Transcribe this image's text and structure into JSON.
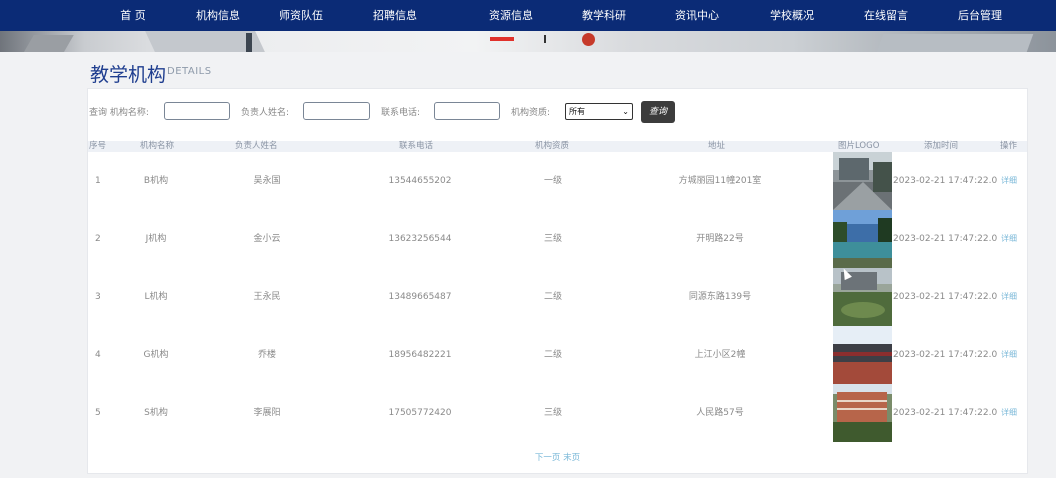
{
  "nav": {
    "items": [
      {
        "key": "home",
        "label": "首 页"
      },
      {
        "key": "org",
        "label": "机构信息"
      },
      {
        "key": "teachers",
        "label": "师资队伍"
      },
      {
        "key": "recruit",
        "label": "招聘信息"
      },
      {
        "key": "resources",
        "label": "资源信息"
      },
      {
        "key": "research",
        "label": "教学科研"
      },
      {
        "key": "news",
        "label": "资讯中心"
      },
      {
        "key": "overview",
        "label": "学校概况"
      },
      {
        "key": "message",
        "label": "在线留言"
      },
      {
        "key": "admin",
        "label": "后台管理"
      }
    ]
  },
  "page": {
    "title": "教学机构",
    "subtitle": "DETAILS"
  },
  "search": {
    "name_label": "查询 机构名称:",
    "name_value": "",
    "leader_label": "负责人姓名:",
    "leader_value": "",
    "phone_label": "联系电话:",
    "phone_value": "",
    "level_label": "机构资质:",
    "level_selected": "所有",
    "button_label": "查询"
  },
  "table": {
    "headers": [
      "序号",
      "机构名称",
      "负责人姓名",
      "联系电话",
      "机构资质",
      "地址",
      "图片LOGO",
      "添加时间",
      "操作"
    ],
    "rows": [
      {
        "no": "1",
        "name": "B机构",
        "leader": "吴永国",
        "phone": "13544655202",
        "level": "一级",
        "address": "方城丽园11幢201室",
        "time": "2023-02-21 17:47:22.0",
        "action": "详细"
      },
      {
        "no": "2",
        "name": "J机构",
        "leader": "金小云",
        "phone": "13623256544",
        "level": "三级",
        "address": "开明路22号",
        "time": "2023-02-21 17:47:22.0",
        "action": "详细"
      },
      {
        "no": "3",
        "name": "L机构",
        "leader": "王永民",
        "phone": "13489665487",
        "level": "二级",
        "address": "同源东路139号",
        "time": "2023-02-21 17:47:22.0",
        "action": "详细"
      },
      {
        "no": "4",
        "name": "G机构",
        "leader": "乔楼",
        "phone": "18956482221",
        "level": "二级",
        "address": "上江小区2幢",
        "time": "2023-02-21 17:47:22.0",
        "action": "详细"
      },
      {
        "no": "5",
        "name": "S机构",
        "leader": "李展阳",
        "phone": "17505772420",
        "level": "三级",
        "address": "人民路57号",
        "time": "2023-02-21 17:47:22.0",
        "action": "详细"
      }
    ]
  },
  "pager": {
    "next": "下一页",
    "last": "末页"
  },
  "colors": {
    "nav_bg": "#0b2b76",
    "title": "#1e3d8f",
    "link": "#7ab8d8"
  }
}
